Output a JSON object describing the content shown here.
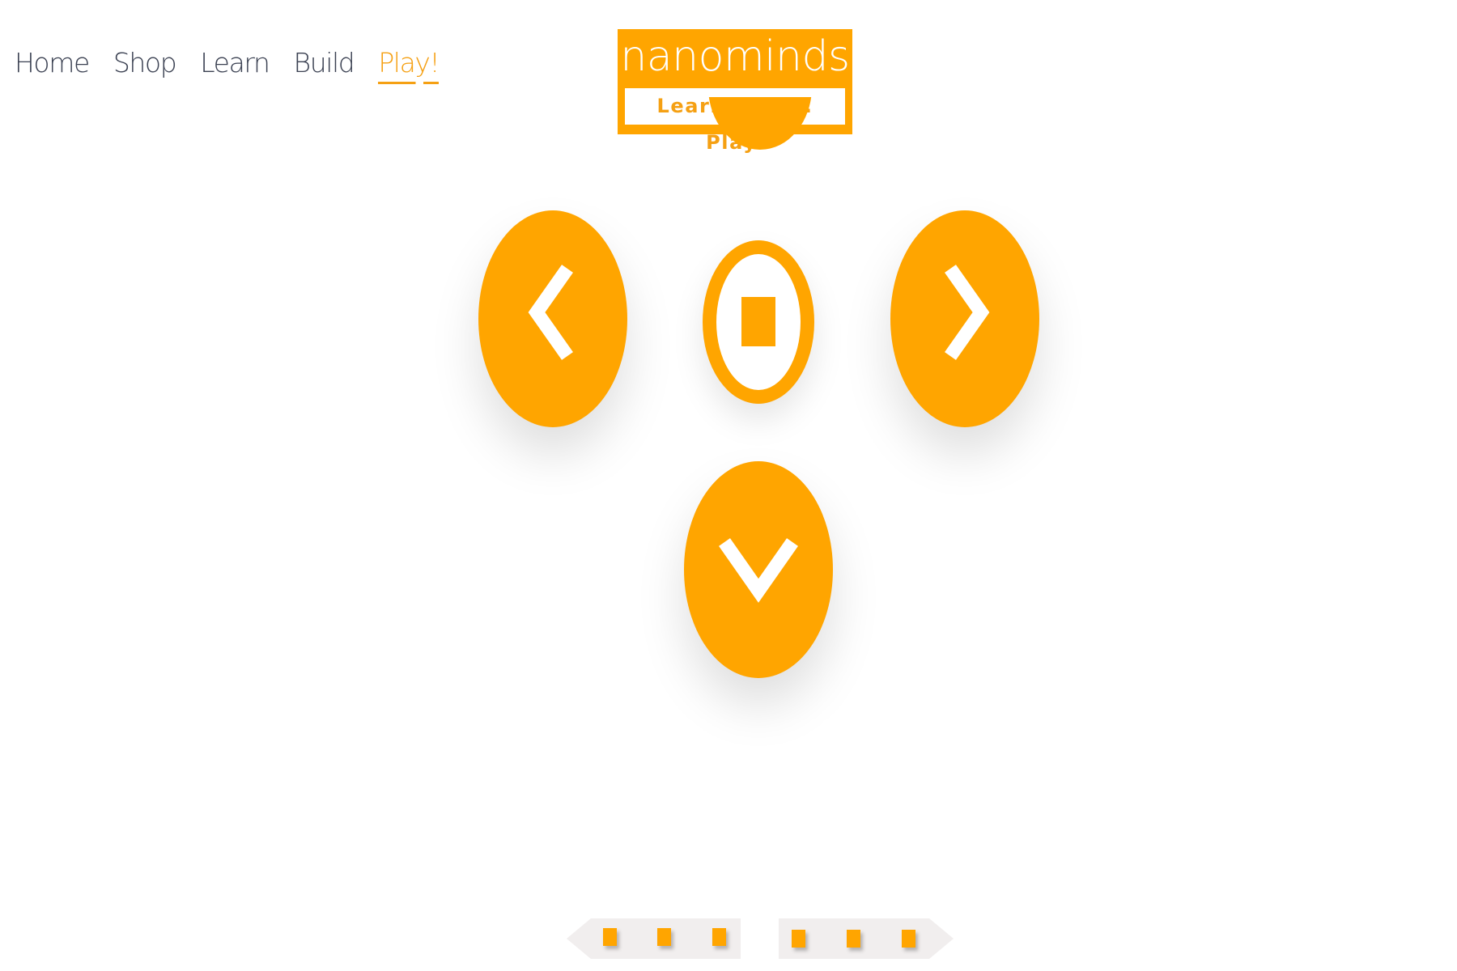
{
  "nav": {
    "items": [
      {
        "label": "Home"
      },
      {
        "label": "Shop"
      },
      {
        "label": "Learn"
      },
      {
        "label": "Build"
      },
      {
        "label": "Play!"
      }
    ],
    "active_item": "Play!"
  },
  "logo": {
    "wordmark": "nanominds",
    "tagline": "Learn. Build. Play."
  },
  "controls": {
    "up": {
      "icon": "chevron-up-icon"
    },
    "left": {
      "icon": "chevron-left-icon"
    },
    "stop": {
      "icon": "stop-icon"
    },
    "right": {
      "icon": "chevron-right-icon"
    },
    "down": {
      "icon": "chevron-down-icon"
    },
    "speed_down": {
      "icon": "arrow-left-dots-icon"
    },
    "speed_up": {
      "icon": "arrow-right-dots-icon"
    }
  },
  "colors": {
    "accent": "#ffa500",
    "nav_text": "#3b4152",
    "nav_active": "#f5a013",
    "slider_track": "#f1eeee"
  }
}
